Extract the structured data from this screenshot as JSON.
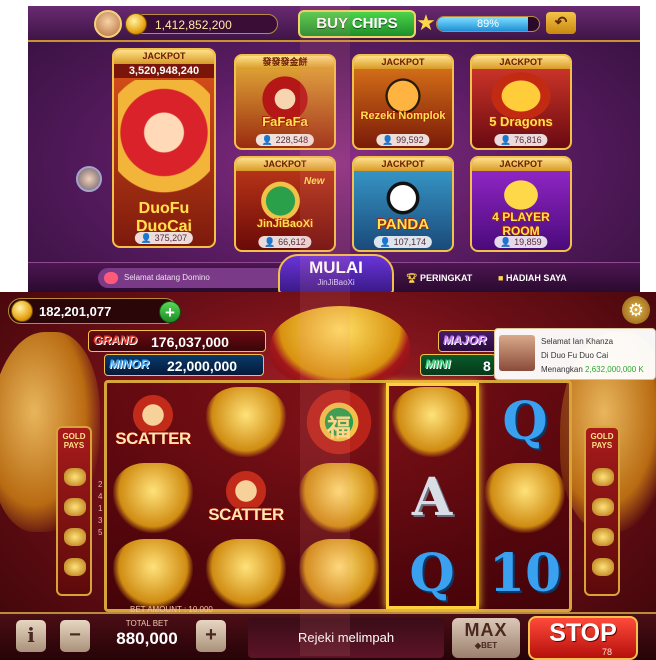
{
  "lobby": {
    "coins": "1,412,852,200",
    "buy_chips_label": "BUY CHIPS",
    "level_percent": "89%",
    "level_fraction": 0.89,
    "jackpot_label": "JACKPOT",
    "featured_jackpot_value": "3,520,948,240",
    "games": [
      {
        "name": "DuoFu DuoCai",
        "players": "375,207",
        "head": "JACKPOT"
      },
      {
        "name": "FaFaFa",
        "players": "228,548",
        "head": "發發發金餅"
      },
      {
        "name": "Rezeki Nomplok",
        "players": "99,592",
        "head": "JACKPOT"
      },
      {
        "name": "5 Dragons",
        "players": "76,816",
        "head": "JACKPOT"
      },
      {
        "name": "JinJiBaoXi",
        "players": "66,612",
        "head": "JACKPOT",
        "badge": "New"
      },
      {
        "name": "PANDA",
        "players": "107,174",
        "head": "JACKPOT"
      },
      {
        "name": "4 PLAYER ROOM",
        "players": "19,859",
        "head": "JACKPOT"
      }
    ],
    "chat_text": "Selamat datang Domino",
    "mulai_label": "MULAI",
    "mulai_sub": "JinJiBaoXi",
    "peringkat_label": "PERINGKAT",
    "hadiah_label": "HADIAH SAYA"
  },
  "slot": {
    "coins": "182,201,077",
    "jackpots": [
      {
        "name": "GRAND",
        "value": "176,037,000"
      },
      {
        "name": "MINOR",
        "value": "22,000,000"
      },
      {
        "name": "MAJOR",
        "value": ""
      },
      {
        "name": "MINI",
        "value": "8"
      }
    ],
    "notification": {
      "line1": "Selamat Ian Khanza",
      "line2": "Di Duo Fu Duo Cai",
      "line3_prefix": "Menangkan",
      "line3_amount": "2,632,000,000 K"
    },
    "reels": [
      [
        "SCATTER",
        "gold-ship",
        "gold-ship"
      ],
      [
        "gold-ship",
        "SCATTER",
        "gold-turtle"
      ],
      [
        "福",
        "gold-ingot",
        "gold-ingot"
      ],
      [
        "gold-turtle",
        "A",
        "Q"
      ],
      [
        "Q",
        "gold-turtle",
        "10"
      ]
    ],
    "gold_pays_label": "GOLD PAYS",
    "line_numbers": [
      "2",
      "4",
      "1",
      "3",
      "5"
    ],
    "bet_amount_label": "BET AMOUNT : 10,000",
    "total_bet_label": "TOTAL BET",
    "total_bet_value": "880,000",
    "message": "Rejeki melimpah",
    "max_label": "MAX",
    "max_sub": "◆BET",
    "stop_label": "STOP",
    "stop_count": "78",
    "info_label": "i",
    "minus_label": "−",
    "plus_label": "+"
  }
}
